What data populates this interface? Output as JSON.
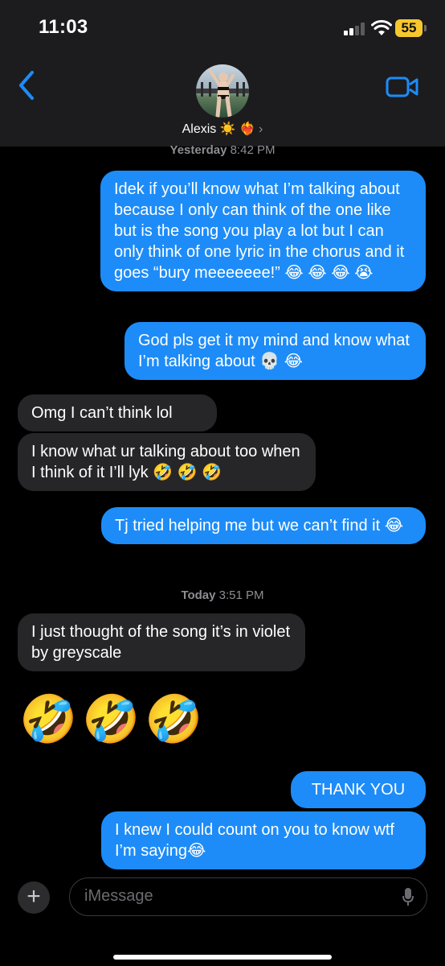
{
  "status_bar": {
    "time": "11:03",
    "battery": "55"
  },
  "header": {
    "contact_name": "Alexis ☀️ ❤️‍🔥",
    "chevron": "›",
    "back_icon": "chevron-left-icon",
    "video_icon": "video-camera-icon"
  },
  "thread": {
    "timestamp1": {
      "day": "Yesterday",
      "time": "8:42 PM"
    },
    "timestamp2": {
      "day": "Today",
      "time": "3:51 PM"
    },
    "messages": [
      {
        "side": "sent",
        "text": "Idek if you’ll know what I’m talking about because I only can think of the one like but is the song you play a lot but I can only think of one lyric in the chorus and it goes “bury meeeeeee!” 😂 😂 😂 😭"
      },
      {
        "side": "sent",
        "text": "God pls get it my mind and know what I’m talking about 💀 😂"
      },
      {
        "side": "received",
        "text": "Omg I can’t think lol"
      },
      {
        "side": "received",
        "text": "I know what ur talking about too when I think of it I’ll lyk 🤣 🤣 🤣"
      },
      {
        "side": "sent",
        "text": "Tj tried helping me but we can’t find it 😂"
      },
      {
        "side": "received",
        "text": "I just thought of the song it’s in violet by greyscale"
      },
      {
        "side": "received",
        "text": "🤣🤣🤣"
      },
      {
        "side": "sent",
        "text": "THANK YOU"
      },
      {
        "side": "sent",
        "text": "I knew I could count on you to know wtf I’m saying😂"
      }
    ]
  },
  "composer": {
    "placeholder": "iMessage",
    "plus": "+"
  },
  "colors": {
    "sent_bubble": "#1d8cf8",
    "received_bubble": "#262628",
    "accent": "#1d8cf8"
  }
}
